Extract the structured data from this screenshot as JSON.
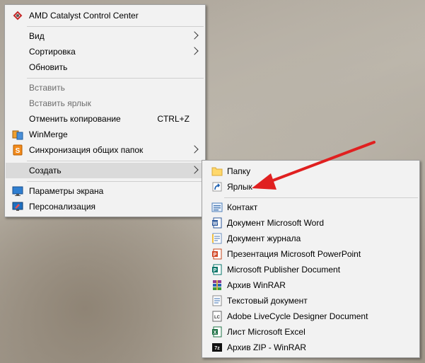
{
  "main_menu": {
    "items": [
      {
        "label": "AMD Catalyst Control Center",
        "icon": "amd-catalyst-icon"
      },
      {
        "label": "Вид",
        "submenu": true
      },
      {
        "label": "Сортировка",
        "submenu": true
      },
      {
        "label": "Обновить"
      },
      {
        "label": "Вставить",
        "disabled": true
      },
      {
        "label": "Вставить ярлык",
        "disabled": true
      },
      {
        "label": "Отменить копирование",
        "shortcut": "CTRL+Z"
      },
      {
        "label": "WinMerge",
        "icon": "winmerge-icon"
      },
      {
        "label": "Синхронизация общих папок",
        "icon": "sync-folders-icon",
        "submenu": true
      },
      {
        "label": "Создать",
        "submenu": true,
        "highlighted": true
      },
      {
        "label": "Параметры экрана",
        "icon": "display-settings-icon"
      },
      {
        "label": "Персонализация",
        "icon": "personalization-icon"
      }
    ]
  },
  "sub_menu": {
    "items": [
      {
        "label": "Папку",
        "icon": "folder-icon"
      },
      {
        "label": "Ярлык",
        "icon": "shortcut-icon"
      },
      {
        "label": "Контакт",
        "icon": "contact-icon"
      },
      {
        "label": "Документ Microsoft Word",
        "icon": "word-icon"
      },
      {
        "label": "Документ журнала",
        "icon": "journal-icon"
      },
      {
        "label": "Презентация Microsoft PowerPoint",
        "icon": "powerpoint-icon"
      },
      {
        "label": "Microsoft Publisher Document",
        "icon": "publisher-icon"
      },
      {
        "label": "Архив WinRAR",
        "icon": "winrar-icon"
      },
      {
        "label": "Текстовый документ",
        "icon": "text-document-icon"
      },
      {
        "label": "Adobe LiveCycle Designer Document",
        "icon": "livecycle-icon"
      },
      {
        "label": "Лист Microsoft Excel",
        "icon": "excel-icon"
      },
      {
        "label": "Архив ZIP - WinRAR",
        "icon": "winrar-zip-icon"
      }
    ]
  },
  "annotation": {
    "type": "red-arrow",
    "points_to": "Ярлык",
    "color": "#e02020"
  }
}
